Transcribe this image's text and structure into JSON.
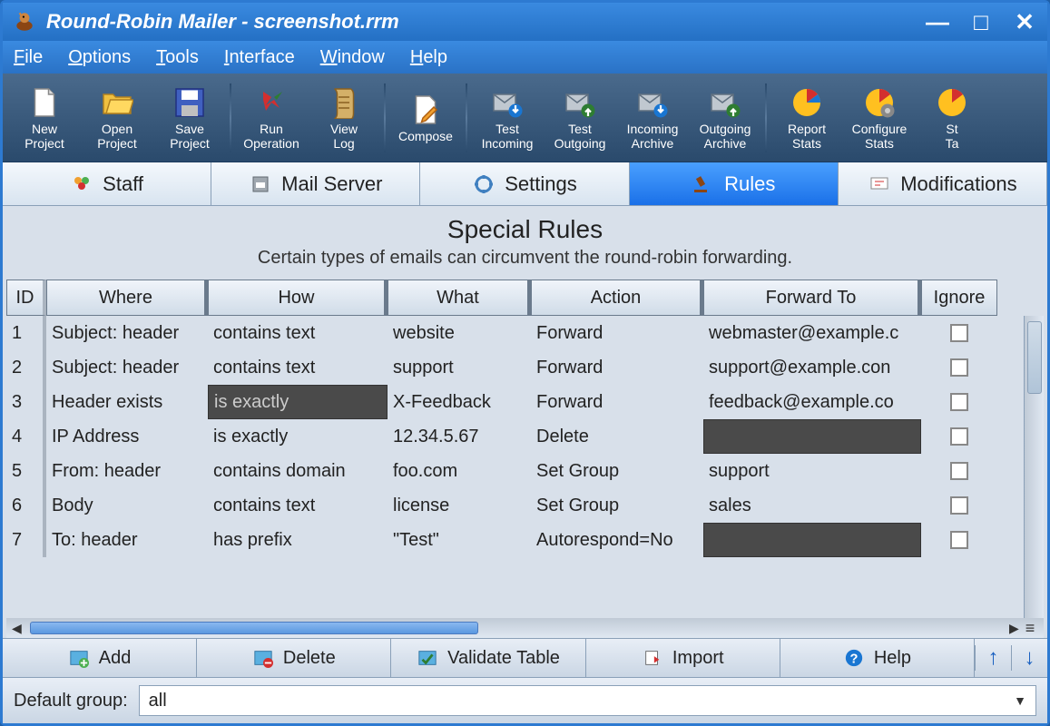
{
  "titlebar": {
    "title": "Round-Robin Mailer - screenshot.rrm"
  },
  "menubar": [
    "File",
    "Options",
    "Tools",
    "Interface",
    "Window",
    "Help"
  ],
  "toolbar": [
    {
      "label": "New\nProject",
      "icon": "file-new-icon"
    },
    {
      "label": "Open\nProject",
      "icon": "folder-open-icon"
    },
    {
      "label": "Save\nProject",
      "icon": "save-icon"
    },
    {
      "sep": true
    },
    {
      "label": "Run\nOperation",
      "icon": "run-icon"
    },
    {
      "label": "View\nLog",
      "icon": "log-icon"
    },
    {
      "sep": true
    },
    {
      "label": "Compose",
      "icon": "compose-icon"
    },
    {
      "sep": true
    },
    {
      "label": "Test\nIncoming",
      "icon": "test-in-icon"
    },
    {
      "label": "Test\nOutgoing",
      "icon": "test-out-icon"
    },
    {
      "label": "Incoming\nArchive",
      "icon": "archive-in-icon"
    },
    {
      "label": "Outgoing\nArchive",
      "icon": "archive-out-icon"
    },
    {
      "sep": true
    },
    {
      "label": "Report\nStats",
      "icon": "report-icon"
    },
    {
      "label": "Configure\nStats",
      "icon": "config-icon"
    },
    {
      "label": "St\nTa",
      "icon": "stats-icon"
    }
  ],
  "tabs": [
    {
      "label": "Staff",
      "icon": "staff-icon"
    },
    {
      "label": "Mail Server",
      "icon": "server-icon"
    },
    {
      "label": "Settings",
      "icon": "settings-icon"
    },
    {
      "label": "Rules",
      "icon": "gavel-icon",
      "active": true
    },
    {
      "label": "Modifications",
      "icon": "mods-icon"
    }
  ],
  "heading": {
    "title": "Special Rules",
    "subtitle": "Certain types of emails can circumvent the round-robin forwarding."
  },
  "columns": [
    "ID",
    "Where",
    "How",
    "What",
    "Action",
    "Forward To",
    "Ignore"
  ],
  "rows": [
    {
      "id": "1",
      "where": "Subject: header",
      "how": "contains text",
      "what": "website",
      "action": "Forward",
      "fwd": "webmaster@example.c",
      "how_dark": false,
      "fwd_dark": false
    },
    {
      "id": "2",
      "where": "Subject: header",
      "how": "contains text",
      "what": "support",
      "action": "Forward",
      "fwd": "support@example.con",
      "how_dark": false,
      "fwd_dark": false
    },
    {
      "id": "3",
      "where": "Header exists",
      "how": "is exactly",
      "what": "X-Feedback",
      "action": "Forward",
      "fwd": "feedback@example.co",
      "how_dark": true,
      "fwd_dark": false
    },
    {
      "id": "4",
      "where": "IP Address",
      "how": "is exactly",
      "what": "12.34.5.67",
      "action": "Delete",
      "fwd": "",
      "how_dark": false,
      "fwd_dark": true
    },
    {
      "id": "5",
      "where": "From: header",
      "how": "contains domain",
      "what": "foo.com",
      "action": "Set Group",
      "fwd": "support",
      "how_dark": false,
      "fwd_dark": false
    },
    {
      "id": "6",
      "where": "Body",
      "how": "contains text",
      "what": "license",
      "action": "Set Group",
      "fwd": "sales",
      "how_dark": false,
      "fwd_dark": false
    },
    {
      "id": "7",
      "where": "To: header",
      "how": "has prefix",
      "what": "\"Test\"",
      "action": "Autorespond=No",
      "fwd": "",
      "how_dark": false,
      "fwd_dark": true
    }
  ],
  "actions": {
    "add": "Add",
    "delete": "Delete",
    "validate": "Validate Table",
    "import": "Import",
    "help": "Help"
  },
  "footer": {
    "label": "Default group:",
    "value": "all"
  }
}
